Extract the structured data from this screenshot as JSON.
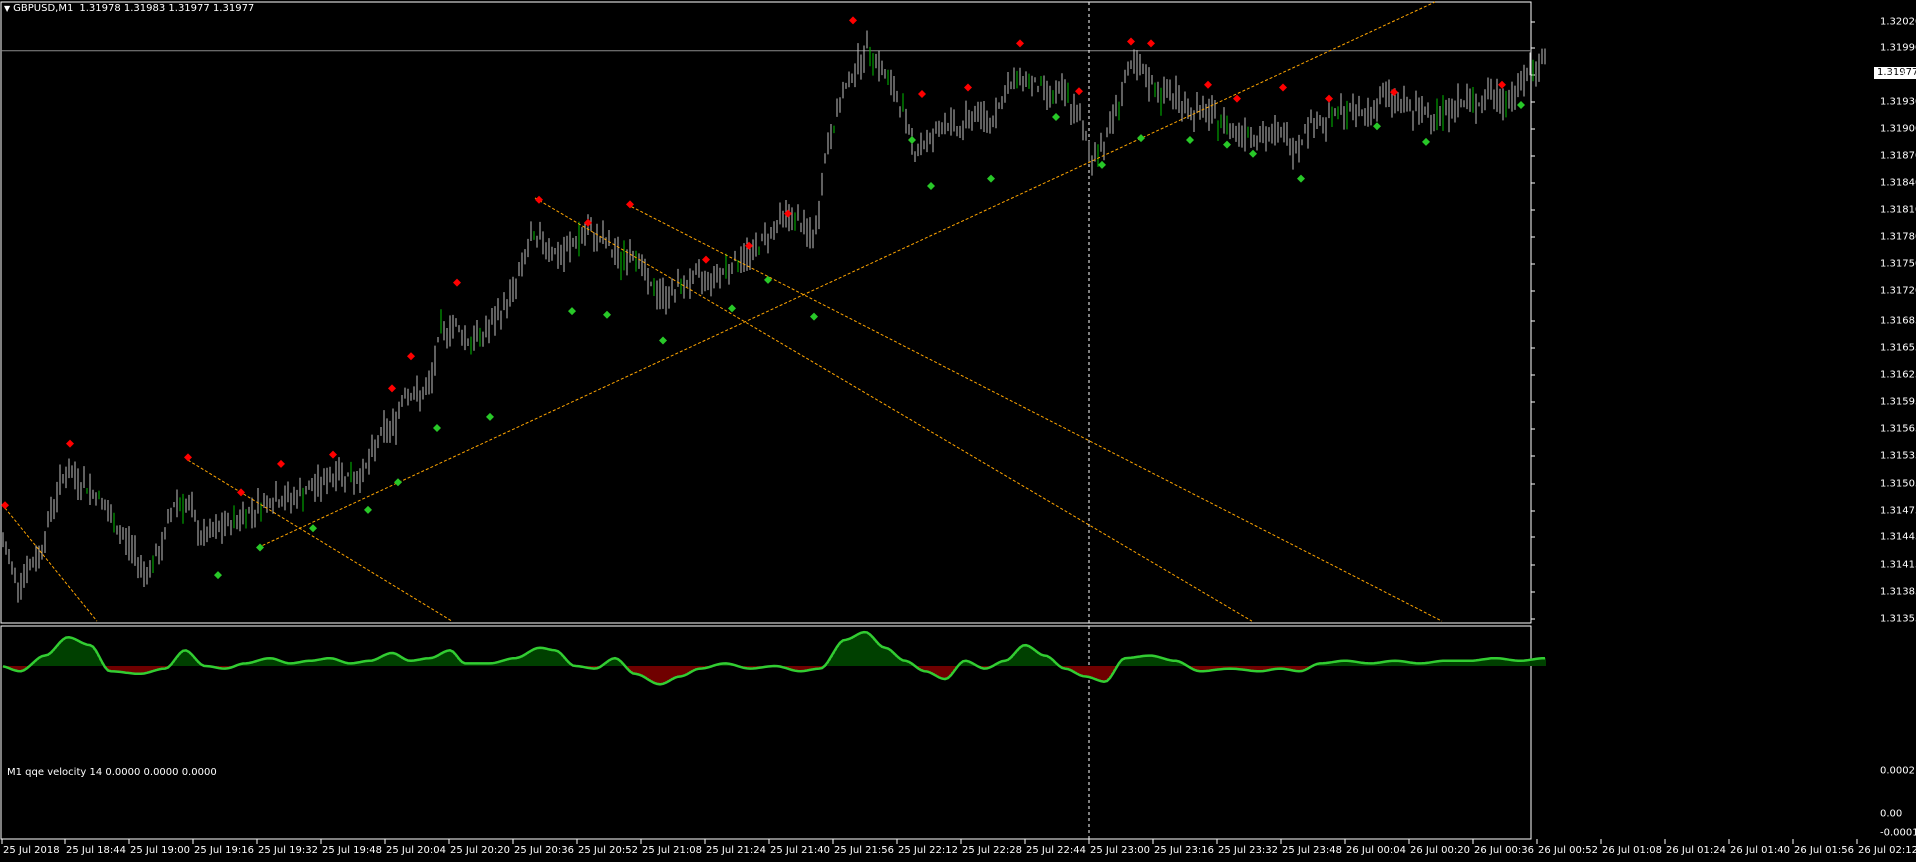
{
  "main_title": {
    "symbol": "GBPUSD,M1",
    "ohlc": "1.31978 1.31983 1.31977 1.31977"
  },
  "sub_title": "M1  qqe velocity 14 0.0000 0.0000 0.0000",
  "current_price": "1.31977",
  "colors": {
    "background": "#000000",
    "bar": "#c0c0c0",
    "bar_up": "#00c000",
    "sell_marker": "#ff0000",
    "buy_marker": "#28c828",
    "trendline": "#ffa500",
    "osc_line": "#32cd32",
    "osc_pos": "#008000",
    "osc_neg": "#e00000",
    "frame": "#ffffff"
  },
  "price_axis": [
    "1.32020",
    "1.31990",
    "1.31960",
    "1.31930",
    "1.31900",
    "1.31870",
    "1.31840",
    "1.31810",
    "1.31780",
    "1.31750",
    "1.31720",
    "1.31685",
    "1.31655",
    "1.31625",
    "1.31595",
    "1.31565",
    "1.31535",
    "1.31505",
    "1.31475",
    "1.31445",
    "1.31415",
    "1.31385",
    "1.31355"
  ],
  "osc_axis": [
    "0.0002",
    "0.00",
    "-0.0001"
  ],
  "time_axis": [
    "25 Jul 2018",
    "25 Jul 18:44",
    "25 Jul 19:00",
    "25 Jul 19:16",
    "25 Jul 19:32",
    "25 Jul 19:48",
    "25 Jul 20:04",
    "25 Jul 20:20",
    "25 Jul 20:36",
    "25 Jul 20:52",
    "25 Jul 21:08",
    "25 Jul 21:24",
    "25 Jul 21:40",
    "25 Jul 21:56",
    "25 Jul 22:12",
    "25 Jul 22:28",
    "25 Jul 22:44",
    "25 Jul 23:00",
    "25 Jul 23:16",
    "25 Jul 23:32",
    "25 Jul 23:48",
    "26 Jul 00:04",
    "26 Jul 00:20",
    "26 Jul 00:36",
    "26 Jul 00:52",
    "26 Jul 01:08",
    "26 Jul 01:24",
    "26 Jul 01:40",
    "26 Jul 01:56",
    "26 Jul 02:12"
  ],
  "chart_data": {
    "type": "line",
    "symbol": "GBPUSD",
    "timeframe": "M1",
    "y_range": [
      1.31355,
      1.3203
    ],
    "price_path": [
      [
        0,
        1.3145
      ],
      [
        18,
        1.314
      ],
      [
        40,
        1.3143
      ],
      [
        52,
        1.3148
      ],
      [
        65,
        1.3152
      ],
      [
        80,
        1.3151
      ],
      [
        100,
        1.3149
      ],
      [
        115,
        1.3146
      ],
      [
        130,
        1.3144
      ],
      [
        145,
        1.3141
      ],
      [
        160,
        1.3143
      ],
      [
        175,
        1.3149
      ],
      [
        190,
        1.3148
      ],
      [
        200,
        1.3145
      ],
      [
        210,
        1.3145
      ],
      [
        225,
        1.3146
      ],
      [
        240,
        1.3147
      ],
      [
        255,
        1.3148
      ],
      [
        270,
        1.3149
      ],
      [
        290,
        1.3149
      ],
      [
        310,
        1.315
      ],
      [
        325,
        1.3151
      ],
      [
        340,
        1.3152
      ],
      [
        355,
        1.3151
      ],
      [
        370,
        1.3153
      ],
      [
        380,
        1.3156
      ],
      [
        395,
        1.3157
      ],
      [
        405,
        1.3161
      ],
      [
        418,
        1.316
      ],
      [
        430,
        1.3161
      ],
      [
        440,
        1.3167
      ],
      [
        455,
        1.3168
      ],
      [
        470,
        1.3166
      ],
      [
        485,
        1.3167
      ],
      [
        500,
        1.3169
      ],
      [
        515,
        1.3172
      ],
      [
        530,
        1.3177
      ],
      [
        545,
        1.3177
      ],
      [
        560,
        1.3175
      ],
      [
        575,
        1.3177
      ],
      [
        590,
        1.3178
      ],
      [
        605,
        1.3177
      ],
      [
        620,
        1.3175
      ],
      [
        635,
        1.3176
      ],
      [
        650,
        1.3172
      ],
      [
        665,
        1.3171
      ],
      [
        680,
        1.3172
      ],
      [
        695,
        1.3173
      ],
      [
        710,
        1.3173
      ],
      [
        725,
        1.3174
      ],
      [
        740,
        1.3175
      ],
      [
        755,
        1.3176
      ],
      [
        770,
        1.3178
      ],
      [
        785,
        1.318
      ],
      [
        800,
        1.3179
      ],
      [
        815,
        1.3177
      ],
      [
        825,
        1.3186
      ],
      [
        840,
        1.3192
      ],
      [
        855,
        1.3196
      ],
      [
        870,
        1.3198
      ],
      [
        885,
        1.3195
      ],
      [
        900,
        1.3192
      ],
      [
        915,
        1.3187
      ],
      [
        930,
        1.3188
      ],
      [
        945,
        1.319
      ],
      [
        960,
        1.3189
      ],
      [
        975,
        1.3191
      ],
      [
        990,
        1.319
      ],
      [
        1005,
        1.3193
      ],
      [
        1020,
        1.3195
      ],
      [
        1035,
        1.3194
      ],
      [
        1050,
        1.3193
      ],
      [
        1065,
        1.3193
      ],
      [
        1080,
        1.319
      ],
      [
        1092,
        1.3186
      ],
      [
        1105,
        1.3188
      ],
      [
        1118,
        1.3192
      ],
      [
        1130,
        1.3196
      ],
      [
        1145,
        1.3195
      ],
      [
        1160,
        1.3193
      ],
      [
        1175,
        1.3193
      ],
      [
        1190,
        1.3191
      ],
      [
        1205,
        1.3191
      ],
      [
        1220,
        1.319
      ],
      [
        1235,
        1.3189
      ],
      [
        1250,
        1.3189
      ],
      [
        1265,
        1.3188
      ],
      [
        1280,
        1.3189
      ],
      [
        1295,
        1.3187
      ],
      [
        1310,
        1.319
      ],
      [
        1325,
        1.319
      ],
      [
        1340,
        1.3191
      ],
      [
        1355,
        1.3191
      ],
      [
        1370,
        1.3191
      ],
      [
        1385,
        1.3193
      ],
      [
        1400,
        1.3192
      ],
      [
        1415,
        1.3191
      ],
      [
        1430,
        1.3191
      ],
      [
        1445,
        1.3191
      ],
      [
        1460,
        1.3192
      ],
      [
        1475,
        1.3192
      ],
      [
        1490,
        1.3193
      ],
      [
        1505,
        1.3192
      ],
      [
        1520,
        1.3194
      ],
      [
        1535,
        1.3196
      ],
      [
        1545,
        1.3197
      ]
    ],
    "sell_signals": [
      [
        5,
        1.31483
      ],
      [
        70,
        1.3155
      ],
      [
        188,
        1.31535
      ],
      [
        241,
        1.31497
      ],
      [
        281,
        1.31528
      ],
      [
        333,
        1.31538
      ],
      [
        392,
        1.3161
      ],
      [
        411,
        1.31645
      ],
      [
        457,
        1.31725
      ],
      [
        539,
        1.31815
      ],
      [
        588,
        1.3179
      ],
      [
        630,
        1.3181
      ],
      [
        706,
        1.3175
      ],
      [
        749,
        1.31765
      ],
      [
        788,
        1.318
      ],
      [
        853,
        1.3201
      ],
      [
        922,
        1.3193
      ],
      [
        968,
        1.31937
      ],
      [
        1020,
        1.31985
      ],
      [
        1079,
        1.31933
      ],
      [
        1131,
        1.31987
      ],
      [
        1151,
        1.31985
      ],
      [
        1208,
        1.3194
      ],
      [
        1237,
        1.31925
      ],
      [
        1283,
        1.31937
      ],
      [
        1329,
        1.31925
      ],
      [
        1394,
        1.31932
      ],
      [
        1502,
        1.3194
      ]
    ],
    "buy_signals": [
      [
        218,
        1.31407
      ],
      [
        260,
        1.31437
      ],
      [
        313,
        1.31458
      ],
      [
        368,
        1.31478
      ],
      [
        398,
        1.31508
      ],
      [
        437,
        1.31567
      ],
      [
        490,
        1.31579
      ],
      [
        572,
        1.31694
      ],
      [
        607,
        1.3169
      ],
      [
        663,
        1.31662
      ],
      [
        732,
        1.31697
      ],
      [
        768,
        1.31728
      ],
      [
        814,
        1.31688
      ],
      [
        912,
        1.3188
      ],
      [
        931,
        1.3183
      ],
      [
        991,
        1.31838
      ],
      [
        1056,
        1.31905
      ],
      [
        1102,
        1.31853
      ],
      [
        1141,
        1.31882
      ],
      [
        1190,
        1.3188
      ],
      [
        1227,
        1.31875
      ],
      [
        1253,
        1.31865
      ],
      [
        1301,
        1.31838
      ],
      [
        1377,
        1.31895
      ],
      [
        1426,
        1.31878
      ],
      [
        1521,
        1.31918
      ]
    ],
    "trendlines": [
      [
        [
          5,
          1.3148
        ],
        [
          97,
          1.31357
        ]
      ],
      [
        [
          188,
          1.31532
        ],
        [
          452,
          1.31357
        ]
      ],
      [
        [
          258,
          1.31437
        ],
        [
          1435,
          1.3203
        ]
      ],
      [
        [
          535,
          1.31817
        ],
        [
          1252,
          1.31357
        ]
      ],
      [
        [
          627,
          1.3181
        ],
        [
          1442,
          1.31357
        ]
      ]
    ],
    "current_price_line": 1.31977,
    "cursor_x_index": 1089,
    "oscillator": {
      "name": "qqe velocity",
      "period": 14,
      "values_text": "0.0000 0.0000 0.0000",
      "y_range": [
        -0.0001,
        0.0002
      ],
      "path": [
        [
          0,
          0.0
        ],
        [
          20,
          -2e-05
        ],
        [
          45,
          4e-05
        ],
        [
          68,
          0.00011
        ],
        [
          90,
          8e-05
        ],
        [
          110,
          -2e-05
        ],
        [
          140,
          -3e-05
        ],
        [
          165,
          -1e-05
        ],
        [
          185,
          6e-05
        ],
        [
          205,
          0.0
        ],
        [
          225,
          -1e-05
        ],
        [
          245,
          1e-05
        ],
        [
          270,
          3e-05
        ],
        [
          290,
          1e-05
        ],
        [
          310,
          2e-05
        ],
        [
          330,
          3e-05
        ],
        [
          350,
          1e-05
        ],
        [
          370,
          2e-05
        ],
        [
          392,
          5e-05
        ],
        [
          410,
          2e-05
        ],
        [
          430,
          3e-05
        ],
        [
          450,
          6e-05
        ],
        [
          465,
          1e-05
        ],
        [
          490,
          1e-05
        ],
        [
          515,
          3e-05
        ],
        [
          540,
          7e-05
        ],
        [
          555,
          6e-05
        ],
        [
          575,
          0.0
        ],
        [
          595,
          -1e-05
        ],
        [
          615,
          3e-05
        ],
        [
          635,
          -3e-05
        ],
        [
          660,
          -7e-05
        ],
        [
          680,
          -4e-05
        ],
        [
          700,
          -1e-05
        ],
        [
          725,
          1e-05
        ],
        [
          750,
          -1e-05
        ],
        [
          775,
          0.0
        ],
        [
          800,
          -2e-05
        ],
        [
          820,
          -1e-05
        ],
        [
          845,
          0.0001
        ],
        [
          865,
          0.00013
        ],
        [
          885,
          7e-05
        ],
        [
          905,
          2e-05
        ],
        [
          925,
          -2e-05
        ],
        [
          945,
          -5e-05
        ],
        [
          965,
          2e-05
        ],
        [
          985,
          -1e-05
        ],
        [
          1005,
          2e-05
        ],
        [
          1025,
          8e-05
        ],
        [
          1045,
          4e-05
        ],
        [
          1065,
          -1e-05
        ],
        [
          1085,
          -4e-05
        ],
        [
          1105,
          -6e-05
        ],
        [
          1125,
          3e-05
        ],
        [
          1150,
          4e-05
        ],
        [
          1175,
          2e-05
        ],
        [
          1200,
          -2e-05
        ],
        [
          1230,
          -1e-05
        ],
        [
          1260,
          -2e-05
        ],
        [
          1280,
          -1e-05
        ],
        [
          1300,
          -2e-05
        ],
        [
          1320,
          1e-05
        ],
        [
          1345,
          2e-05
        ],
        [
          1370,
          1e-05
        ],
        [
          1395,
          2e-05
        ],
        [
          1420,
          1e-05
        ],
        [
          1445,
          2e-05
        ],
        [
          1470,
          2e-05
        ],
        [
          1495,
          3e-05
        ],
        [
          1520,
          2e-05
        ],
        [
          1545,
          3e-05
        ]
      ]
    }
  }
}
